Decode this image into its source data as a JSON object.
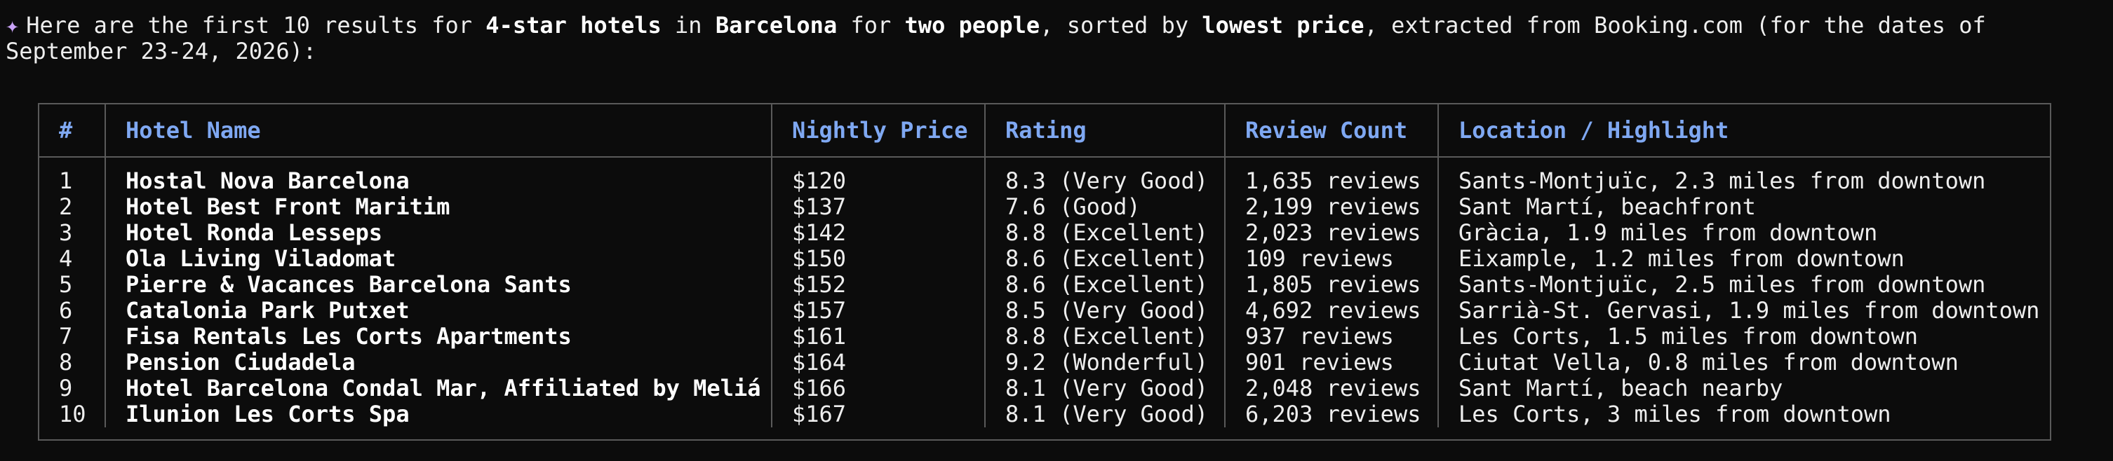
{
  "intro": {
    "sparkle": "✦",
    "parts": [
      {
        "text": "Here are the first 10 results for ",
        "bold": false
      },
      {
        "text": "4-star hotels",
        "bold": true
      },
      {
        "text": " in ",
        "bold": false
      },
      {
        "text": "Barcelona",
        "bold": true
      },
      {
        "text": " for ",
        "bold": false
      },
      {
        "text": "two people",
        "bold": true
      },
      {
        "text": ", sorted by ",
        "bold": false
      },
      {
        "text": "lowest price",
        "bold": true
      },
      {
        "text": ", extracted from Booking.com (for the dates of September 23-24, 2026):",
        "bold": false
      }
    ]
  },
  "table": {
    "headers": [
      "#",
      "Hotel Name",
      "Nightly Price",
      "Rating",
      "Review Count",
      "Location / Highlight"
    ],
    "rows": [
      [
        "1",
        "Hostal Nova Barcelona",
        "$120",
        "8.3 (Very Good)",
        "1,635 reviews",
        "Sants-Montjuïc, 2.3 miles from downtown"
      ],
      [
        "2",
        "Hotel Best Front Maritim",
        "$137",
        "7.6 (Good)",
        "2,199 reviews",
        "Sant Martí, beachfront"
      ],
      [
        "3",
        "Hotel Ronda Lesseps",
        "$142",
        "8.8 (Excellent)",
        "2,023 reviews",
        "Gràcia, 1.9 miles from downtown"
      ],
      [
        "4",
        "Ola Living Viladomat",
        "$150",
        "8.6 (Excellent)",
        "109 reviews",
        "Eixample, 1.2 miles from downtown"
      ],
      [
        "5",
        "Pierre & Vacances Barcelona Sants",
        "$152",
        "8.6 (Excellent)",
        "1,805 reviews",
        "Sants-Montjuïc, 2.5 miles from downtown"
      ],
      [
        "6",
        "Catalonia Park Putxet",
        "$157",
        "8.5 (Very Good)",
        "4,692 reviews",
        "Sarrià-St. Gervasi, 1.9 miles from downtown"
      ],
      [
        "7",
        "Fisa Rentals Les Corts Apartments",
        "$161",
        "8.8 (Excellent)",
        "937 reviews",
        "Les Corts, 1.5 miles from downtown"
      ],
      [
        "8",
        "Pension Ciudadela",
        "$164",
        "9.2 (Wonderful)",
        "901 reviews",
        "Ciutat Vella, 0.8 miles from downtown"
      ],
      [
        "9",
        "Hotel Barcelona Condal Mar, Affiliated by Meliá",
        "$166",
        "8.1 (Very Good)",
        "2,048 reviews",
        "Sant Martí, beach nearby"
      ],
      [
        "10",
        "Ilunion Les Corts Spa",
        "$167",
        "8.1 (Very Good)",
        "6,203 reviews",
        "Les Corts, 3 miles from downtown"
      ]
    ]
  },
  "colors": {
    "background": "#0c0c0c",
    "text": "#eeeeee",
    "header": "#7fa8f2",
    "border": "#5a5a5a",
    "sparkle": "#c9a3f7"
  }
}
